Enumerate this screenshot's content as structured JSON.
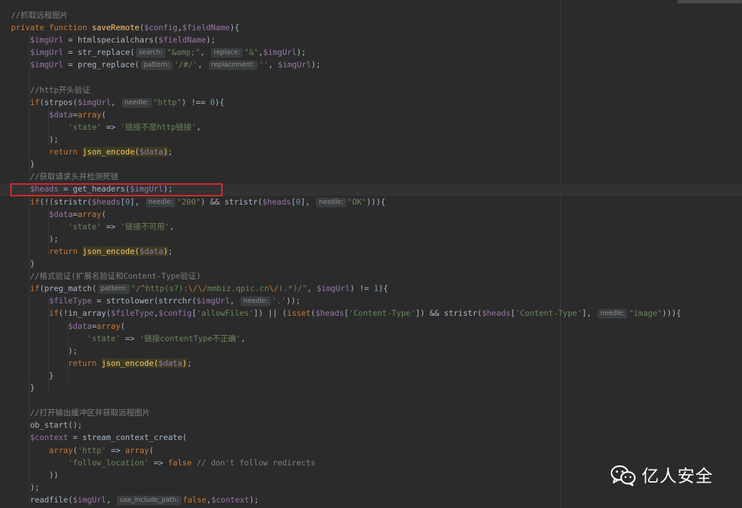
{
  "code_lines": [
    [
      {
        "t": "c",
        "v": "//抓取远程图片"
      }
    ],
    [
      {
        "t": "k",
        "v": "private function "
      },
      {
        "t": "f",
        "v": "saveRemote"
      },
      {
        "t": "p",
        "v": "("
      },
      {
        "t": "v",
        "v": "$config"
      },
      {
        "t": "p",
        "v": ","
      },
      {
        "t": "v",
        "v": "$fieldName"
      },
      {
        "t": "p",
        "v": "){"
      }
    ],
    [
      {
        "t": "p",
        "v": "    "
      },
      {
        "t": "v",
        "v": "$imgUrl"
      },
      {
        "t": "p",
        "v": " = htmlspecialchars("
      },
      {
        "t": "v",
        "v": "$fieldName"
      },
      {
        "t": "p",
        "v": ");"
      }
    ],
    [
      {
        "t": "p",
        "v": "    "
      },
      {
        "t": "v",
        "v": "$imgUrl"
      },
      {
        "t": "p",
        "v": " = str_replace("
      },
      {
        "t": "h",
        "v": "search:"
      },
      {
        "t": "s",
        "v": "\"&amp;\""
      },
      {
        "t": "p",
        "v": ", "
      },
      {
        "t": "h",
        "v": "replace:"
      },
      {
        "t": "s",
        "v": "\"&\""
      },
      {
        "t": "p",
        "v": ","
      },
      {
        "t": "v",
        "v": "$imgUrl"
      },
      {
        "t": "p",
        "v": ");"
      }
    ],
    [
      {
        "t": "p",
        "v": "    "
      },
      {
        "t": "v",
        "v": "$imgUrl"
      },
      {
        "t": "p",
        "v": " = preg_replace("
      },
      {
        "t": "h",
        "v": "pattern:"
      },
      {
        "t": "s",
        "v": "'/#/'"
      },
      {
        "t": "p",
        "v": ", "
      },
      {
        "t": "h",
        "v": "replacement:"
      },
      {
        "t": "s",
        "v": "''"
      },
      {
        "t": "p",
        "v": ", "
      },
      {
        "t": "v",
        "v": "$imgUrl"
      },
      {
        "t": "p",
        "v": ");"
      }
    ],
    [],
    [
      {
        "t": "p",
        "v": "    "
      },
      {
        "t": "c",
        "v": "//http开头验证"
      }
    ],
    [
      {
        "t": "p",
        "v": "    "
      },
      {
        "t": "k",
        "v": "if"
      },
      {
        "t": "p",
        "v": "(strpos("
      },
      {
        "t": "v",
        "v": "$imgUrl"
      },
      {
        "t": "p",
        "v": ", "
      },
      {
        "t": "h",
        "v": "needle:"
      },
      {
        "t": "s",
        "v": "\"http\""
      },
      {
        "t": "p",
        "v": ") !== "
      },
      {
        "t": "n",
        "v": "0"
      },
      {
        "t": "p",
        "v": "){"
      }
    ],
    [
      {
        "t": "p",
        "v": "        "
      },
      {
        "t": "v",
        "v": "$data"
      },
      {
        "t": "p",
        "v": "="
      },
      {
        "t": "k",
        "v": "array"
      },
      {
        "t": "p",
        "v": "("
      }
    ],
    [
      {
        "t": "p",
        "v": "            "
      },
      {
        "t": "s",
        "v": "'state'"
      },
      {
        "t": "p",
        "v": " => "
      },
      {
        "t": "s",
        "v": "'链接不是http链接'"
      },
      {
        "t": "p",
        "v": ","
      }
    ],
    [
      {
        "t": "p",
        "v": "        );"
      }
    ],
    [
      {
        "t": "p",
        "v": "        "
      },
      {
        "t": "k",
        "v": "return "
      },
      {
        "t": "x",
        "v": "json_encode("
      },
      {
        "t": "xv",
        "v": "$data"
      },
      {
        "t": "x",
        "v": ")"
      },
      {
        "t": "p",
        "v": ";"
      }
    ],
    [
      {
        "t": "p",
        "v": "    }"
      }
    ],
    [
      {
        "t": "p",
        "v": "    "
      },
      {
        "t": "c",
        "v": "//获取请求头并检测死链"
      }
    ],
    [
      {
        "t": "p",
        "v": "    "
      },
      {
        "t": "v",
        "v": "$heads"
      },
      {
        "t": "p",
        "v": " = get_headers("
      },
      {
        "t": "v",
        "v": "$imgUrl"
      },
      {
        "t": "p",
        "v": ");"
      }
    ],
    [
      {
        "t": "p",
        "v": "    "
      },
      {
        "t": "k",
        "v": "if"
      },
      {
        "t": "p",
        "v": "(!(stristr("
      },
      {
        "t": "v",
        "v": "$heads"
      },
      {
        "t": "p",
        "v": "["
      },
      {
        "t": "n",
        "v": "0"
      },
      {
        "t": "p",
        "v": "], "
      },
      {
        "t": "h",
        "v": "needle:"
      },
      {
        "t": "s",
        "v": "\"200\""
      },
      {
        "t": "p",
        "v": ") && stristr("
      },
      {
        "t": "v",
        "v": "$heads"
      },
      {
        "t": "p",
        "v": "["
      },
      {
        "t": "n",
        "v": "0"
      },
      {
        "t": "p",
        "v": "], "
      },
      {
        "t": "h",
        "v": "needle:"
      },
      {
        "t": "s",
        "v": "\"OK\""
      },
      {
        "t": "p",
        "v": "))){"
      }
    ],
    [
      {
        "t": "p",
        "v": "        "
      },
      {
        "t": "v",
        "v": "$data"
      },
      {
        "t": "p",
        "v": "="
      },
      {
        "t": "k",
        "v": "array"
      },
      {
        "t": "p",
        "v": "("
      }
    ],
    [
      {
        "t": "p",
        "v": "            "
      },
      {
        "t": "s",
        "v": "'state'"
      },
      {
        "t": "p",
        "v": " => "
      },
      {
        "t": "s",
        "v": "'链接不可用'"
      },
      {
        "t": "p",
        "v": ","
      }
    ],
    [
      {
        "t": "p",
        "v": "        );"
      }
    ],
    [
      {
        "t": "p",
        "v": "        "
      },
      {
        "t": "k",
        "v": "return "
      },
      {
        "t": "x",
        "v": "json_encode("
      },
      {
        "t": "xv",
        "v": "$data"
      },
      {
        "t": "x",
        "v": ")"
      },
      {
        "t": "p",
        "v": ";"
      }
    ],
    [
      {
        "t": "p",
        "v": "    }"
      }
    ],
    [
      {
        "t": "p",
        "v": "    "
      },
      {
        "t": "c",
        "v": "//格式验证(扩展名验证和Content-Type验证)"
      }
    ],
    [
      {
        "t": "p",
        "v": "    "
      },
      {
        "t": "k",
        "v": "if"
      },
      {
        "t": "p",
        "v": "(preg_match("
      },
      {
        "t": "h",
        "v": "pattern:"
      },
      {
        "t": "s",
        "v": "\"/"
      },
      {
        "t": "e",
        "v": "^"
      },
      {
        "t": "s",
        "v": "http(s?)"
      },
      {
        "t": "e",
        "v": ":\\/\\/"
      },
      {
        "t": "s",
        "v": "mmbiz.qpic.cn"
      },
      {
        "t": "e",
        "v": "\\/"
      },
      {
        "t": "s",
        "v": "(.*)/\""
      },
      {
        "t": "p",
        "v": ", "
      },
      {
        "t": "v",
        "v": "$imgUrl"
      },
      {
        "t": "p",
        "v": ") != "
      },
      {
        "t": "n",
        "v": "1"
      },
      {
        "t": "p",
        "v": "){"
      }
    ],
    [
      {
        "t": "p",
        "v": "        "
      },
      {
        "t": "v",
        "v": "$fileType"
      },
      {
        "t": "p",
        "v": " = strtolower(strrchr("
      },
      {
        "t": "v",
        "v": "$imgUrl"
      },
      {
        "t": "p",
        "v": ", "
      },
      {
        "t": "h",
        "v": "needle:"
      },
      {
        "t": "s",
        "v": "'.'"
      },
      {
        "t": "p",
        "v": "));"
      }
    ],
    [
      {
        "t": "p",
        "v": "        "
      },
      {
        "t": "k",
        "v": "if"
      },
      {
        "t": "p",
        "v": "(!in_array("
      },
      {
        "t": "v",
        "v": "$fileType"
      },
      {
        "t": "p",
        "v": ","
      },
      {
        "t": "v",
        "v": "$config"
      },
      {
        "t": "p",
        "v": "["
      },
      {
        "t": "s",
        "v": "'allowFiles'"
      },
      {
        "t": "p",
        "v": "]) || ("
      },
      {
        "t": "k",
        "v": "isset"
      },
      {
        "t": "p",
        "v": "("
      },
      {
        "t": "v",
        "v": "$heads"
      },
      {
        "t": "p",
        "v": "["
      },
      {
        "t": "s",
        "v": "'Content-Type'"
      },
      {
        "t": "p",
        "v": "]) && stristr("
      },
      {
        "t": "v",
        "v": "$heads"
      },
      {
        "t": "p",
        "v": "["
      },
      {
        "t": "s",
        "v": "'Content-Type'"
      },
      {
        "t": "p",
        "v": "], "
      },
      {
        "t": "h",
        "v": "needle:"
      },
      {
        "t": "s",
        "v": "\"image\""
      },
      {
        "t": "p",
        "v": "))){"
      }
    ],
    [
      {
        "t": "p",
        "v": "            "
      },
      {
        "t": "v",
        "v": "$data"
      },
      {
        "t": "p",
        "v": "="
      },
      {
        "t": "k",
        "v": "array"
      },
      {
        "t": "p",
        "v": "("
      }
    ],
    [
      {
        "t": "p",
        "v": "                "
      },
      {
        "t": "s",
        "v": "'state'"
      },
      {
        "t": "p",
        "v": " => "
      },
      {
        "t": "s",
        "v": "'链接contentType不正确'"
      },
      {
        "t": "p",
        "v": ","
      }
    ],
    [
      {
        "t": "p",
        "v": "            );"
      }
    ],
    [
      {
        "t": "p",
        "v": "            "
      },
      {
        "t": "k",
        "v": "return "
      },
      {
        "t": "x",
        "v": "json_encode("
      },
      {
        "t": "xv",
        "v": "$data"
      },
      {
        "t": "x",
        "v": ")"
      },
      {
        "t": "p",
        "v": ";"
      }
    ],
    [
      {
        "t": "p",
        "v": "        }"
      }
    ],
    [
      {
        "t": "p",
        "v": "    }"
      }
    ],
    [],
    [
      {
        "t": "p",
        "v": "    "
      },
      {
        "t": "c",
        "v": "//打开输出缓冲区并获取远程图片"
      }
    ],
    [
      {
        "t": "p",
        "v": "    ob_start();"
      }
    ],
    [
      {
        "t": "p",
        "v": "    "
      },
      {
        "t": "v",
        "v": "$context"
      },
      {
        "t": "p",
        "v": " = stream_context_create("
      }
    ],
    [
      {
        "t": "p",
        "v": "        "
      },
      {
        "t": "k",
        "v": "array"
      },
      {
        "t": "p",
        "v": "("
      },
      {
        "t": "s",
        "v": "'http'"
      },
      {
        "t": "p",
        "v": " => "
      },
      {
        "t": "k",
        "v": "array"
      },
      {
        "t": "p",
        "v": "("
      }
    ],
    [
      {
        "t": "p",
        "v": "            "
      },
      {
        "t": "s",
        "v": "'follow_location'"
      },
      {
        "t": "p",
        "v": " => "
      },
      {
        "t": "k",
        "v": "false"
      },
      {
        "t": "p",
        "v": " "
      },
      {
        "t": "c",
        "v": "// don't follow redirects"
      }
    ],
    [
      {
        "t": "p",
        "v": "        ))"
      }
    ],
    [
      {
        "t": "p",
        "v": "    );"
      }
    ],
    [
      {
        "t": "p",
        "v": "    readfile("
      },
      {
        "t": "v",
        "v": "$imgUrl"
      },
      {
        "t": "p",
        "v": ", "
      },
      {
        "t": "h",
        "v": "use_include_path:"
      },
      {
        "t": "k",
        "v": "false"
      },
      {
        "t": "p",
        "v": ","
      },
      {
        "t": "v",
        "v": "$context"
      },
      {
        "t": "p",
        "v": ");"
      }
    ]
  ],
  "watermark": {
    "text": "亿人安全",
    "icon": "wechat-icon"
  },
  "colors": {
    "background": "#2b2b2b",
    "keyword": "#cc7832",
    "function": "#ffc66d",
    "variable": "#9876aa",
    "string": "#6a8759",
    "number": "#6897bb",
    "comment": "#808080",
    "highlight_box": "#e1262b"
  }
}
